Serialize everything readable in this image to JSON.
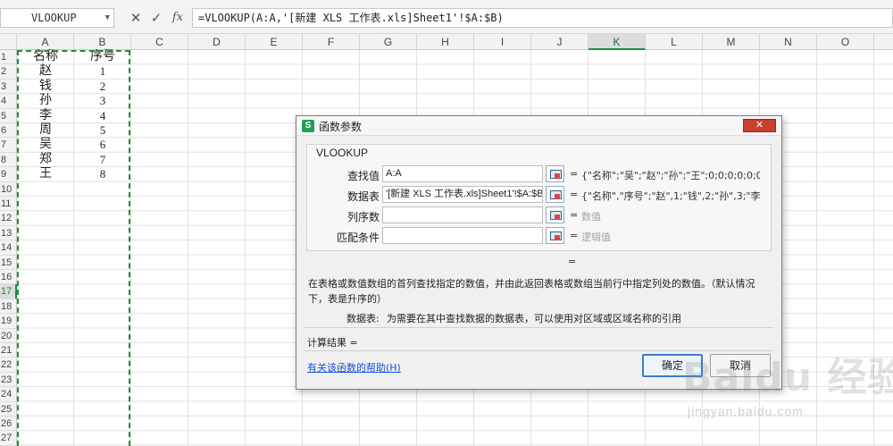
{
  "formula_bar": {
    "name_box": "VLOOKUP",
    "cancel_icon": "✕",
    "accept_icon": "✓",
    "fx_label": "fx",
    "formula": "=VLOOKUP(A:A,'[新建 XLS 工作表.xls]Sheet1'!$A:$B)"
  },
  "grid": {
    "columns": [
      "A",
      "B",
      "C",
      "D",
      "E",
      "F",
      "G",
      "H",
      "I",
      "J",
      "K",
      "L",
      "M",
      "N",
      "O"
    ],
    "active_column": "K",
    "rows": [
      "1",
      "2",
      "3",
      "4",
      "5",
      "6",
      "7",
      "8",
      "9",
      "10",
      "11",
      "12",
      "13",
      "14",
      "15",
      "16",
      "17",
      "18",
      "19",
      "20",
      "21",
      "22",
      "23",
      "24",
      "25",
      "26",
      "27"
    ],
    "active_row": "17",
    "cells": [
      {
        "a": "名称",
        "b": "序号"
      },
      {
        "a": "赵",
        "b": "1"
      },
      {
        "a": "钱",
        "b": "2"
      },
      {
        "a": "孙",
        "b": "3"
      },
      {
        "a": "李",
        "b": "4"
      },
      {
        "a": "周",
        "b": "5"
      },
      {
        "a": "吴",
        "b": "6"
      },
      {
        "a": "郑",
        "b": "7"
      },
      {
        "a": "王",
        "b": "8"
      }
    ]
  },
  "dialog": {
    "logo": "S",
    "title": "函数参数",
    "close": "✕",
    "function_name": "VLOOKUP",
    "args": [
      {
        "label": "查找值",
        "value": "A:A",
        "eq": "=",
        "result": "{\"名称\";\"吴\";\"赵\";\"孙\";\"王\";0;0;0;0;0;0;0;0;0;0;0;0...",
        "hint": false
      },
      {
        "label": "数据表",
        "value": "'[新建 XLS 工作表.xls]Sheet1'!$A:$B",
        "eq": "=",
        "result": "{\"名称\",\"序号\";\"赵\",1;\"钱\",2;\"孙\",3;\"李\",4;...",
        "hint": false
      },
      {
        "label": "列序数",
        "value": "",
        "eq": "=",
        "result": "数值",
        "hint": true
      },
      {
        "label": "匹配条件",
        "value": "",
        "eq": "=",
        "result": "逻辑值",
        "hint": true
      }
    ],
    "result_eq": "=",
    "description": "在表格或数值数组的首列查找指定的数值，并由此返回表格或数组当前行中指定列处的数值。（默认情况下，表是升序的）",
    "param_desc_label": "数据表:",
    "param_desc_text": "为需要在其中查找数据的数据表，可以使用对区域或区域名称的引用",
    "calc_result": "计算结果 =",
    "help_link": "有关该函数的帮助(H)",
    "ok": "确定",
    "cancel": "取消"
  },
  "watermark": {
    "logo_text": "Baidu 经验",
    "url": "jingyan.baidu.com"
  },
  "colors": {
    "accent_green": "#1e8f3e",
    "link_blue": "#1a4fd6",
    "close_red": "#c84031"
  }
}
